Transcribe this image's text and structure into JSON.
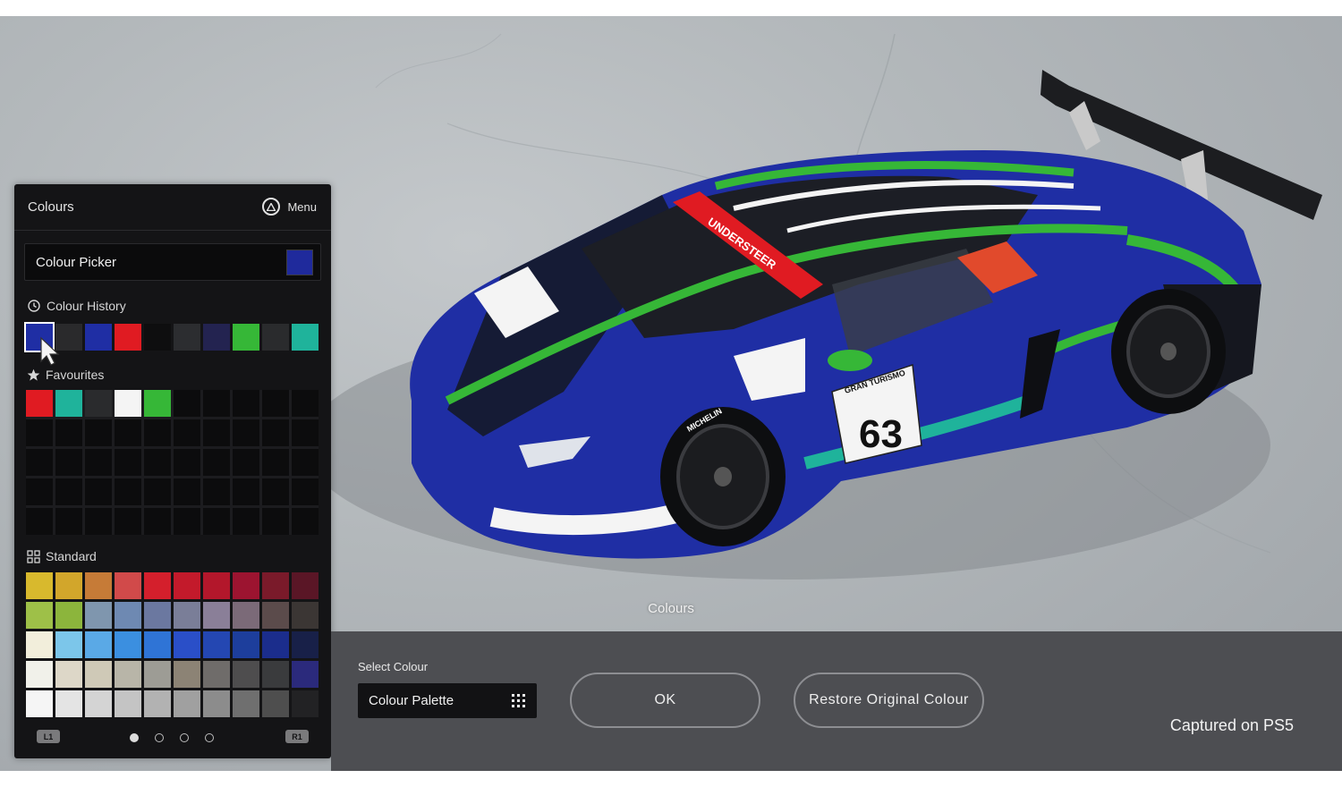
{
  "panel": {
    "title": "Colours",
    "menu_label": "Menu",
    "menu_icon": "triangle-button-icon",
    "picker_label": "Colour Picker",
    "picker_color": "#1f2a9c",
    "history_title": "Colour History",
    "history_icon": "history-clock-icon",
    "history": [
      "#1f2ea4",
      "#2a2a2c",
      "#1f2ea4",
      "#e01b22",
      "#0e0e0f",
      "#2c2d30",
      "#232350",
      "#36b737",
      "#2a2b2d",
      "#1fb39b"
    ],
    "favourites_title": "Favourites",
    "favourites_icon": "star-icon",
    "favourites": [
      "#e01b22",
      "#1fb39b",
      "#2a2b2d",
      "#f4f4f4",
      "#36b737"
    ],
    "standard_title": "Standard",
    "standard_icon": "grid-icon",
    "standard": [
      [
        "#d8b92d",
        "#d2a62b",
        "#c67b37",
        "#d14a4a",
        "#d41f2c",
        "#c31a2b",
        "#b3172b",
        "#9c1430",
        "#7a1a2a",
        "#5a1626"
      ],
      [
        "#9ec048",
        "#8cb53c",
        "#7f96ae",
        "#6e89b2",
        "#6b78a0",
        "#7a7e98",
        "#8a7f98",
        "#7b6a78",
        "#5b4b4b",
        "#3b3634"
      ],
      [
        "#f2eedb",
        "#7cc6ea",
        "#5aa9e6",
        "#3b8fe0",
        "#2f74d6",
        "#2a4fc8",
        "#2447b2",
        "#1d3e9c",
        "#1b2d8c",
        "#182048"
      ],
      [
        "#f1f1ea",
        "#ddd7c8",
        "#cfc9b7",
        "#b8b5a8",
        "#9d9c95",
        "#8c8375",
        "#6f6c6a",
        "#4e4d4e",
        "#3a3b3d",
        "#2b2a7c"
      ],
      [
        "#f5f5f5",
        "#e4e4e4",
        "#d4d4d4",
        "#c4c4c4",
        "#b2b2b2",
        "#a0a0a0",
        "#8c8c8c",
        "#6f6f6f",
        "#4e4e4e",
        "#222224"
      ]
    ],
    "l1_label": "L1",
    "r1_label": "R1",
    "pages": 4,
    "active_page": 1
  },
  "caption": "Colours",
  "bottom": {
    "select_label": "Select Colour",
    "palette_label": "Colour Palette",
    "palette_icon": "grid-dots-icon",
    "ok_label": "OK",
    "restore_label": "Restore Original Colour",
    "capture_label": "Captured on PS5"
  },
  "car": {
    "race_number": "63",
    "windscreen_banner": "UNDERSTEER",
    "door_sponsor": "GRAN TURISMO",
    "tyre_brand": "MICHELIN",
    "body_color": "#1f2ea4",
    "accent_green": "#36b737",
    "accent_teal": "#1fb39b",
    "banner_red": "#e01b22"
  }
}
